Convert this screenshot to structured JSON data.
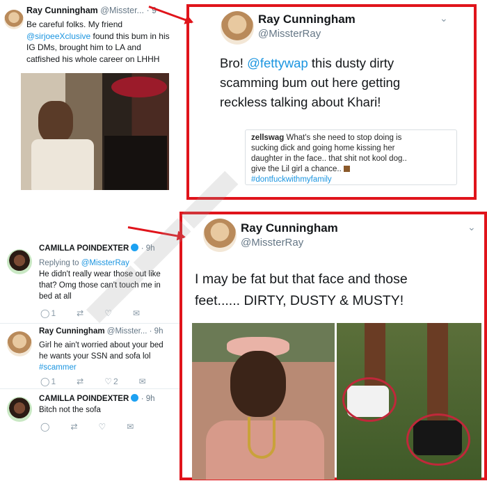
{
  "top_left": {
    "name": "Ray Cunningham",
    "handle": "@Misster...",
    "time": "· 9",
    "line1": "Be careful folks. My friend",
    "mention": "@sirjoeeXclusive",
    "line2_rest": " found this bum in his",
    "line3": "IG DMs, brought him to LA and",
    "line4": "catfished his whole career on LHHH"
  },
  "top_right": {
    "name": "Ray Cunningham",
    "handle": "@MissterRay",
    "bro": "Bro! ",
    "mention": "@fettywap",
    "rest1": " this dusty dirty",
    "line2": "scamming bum out here getting",
    "line3": "reckless talking about Khari!",
    "quote": {
      "user": "zellswag",
      "text1": " What's she need to stop doing is",
      "text2": "sucking dick and going home kissing her",
      "text3": "daughter in the face.. that shit not kool dog..",
      "text4": "give the Lil girl a chance.. ",
      "hashtag": "#dontfuckwithmyfamily"
    }
  },
  "bottom_left": {
    "reply1": {
      "name": "CAMILLA POINDEXTER",
      "time": "· 9h",
      "replying_label": "Replying to ",
      "replying_handle": "@MissterRay",
      "line1": "He didn't really wear those out like",
      "line2": "that? Omg those can't touch me in",
      "line3": "bed at all",
      "reply_count": "1"
    },
    "reply2": {
      "name": "Ray Cunningham",
      "handle": "@Misster...",
      "time": "· 9h",
      "line1": "Girl he ain't worried about your bed",
      "line2": "he wants your SSN and sofa lol",
      "hashtag": "#scammer",
      "reply_count": "1",
      "like_count": "2"
    },
    "reply3": {
      "name": "CAMILLA POINDEXTER",
      "time": "· 9h",
      "line1": "Bitch not the sofa"
    }
  },
  "bottom_right": {
    "name": "Ray Cunningham",
    "handle": "@MissterRay",
    "line1": "I may be fat but that face and those",
    "line2": "feet...... DIRTY, DUSTY & MUSTY!"
  },
  "colors": {
    "highlight": "#e0141b",
    "link": "#1b95e0"
  },
  "icons": [
    "reply-icon",
    "retweet-icon",
    "like-icon",
    "dm-icon",
    "chevron-down-icon",
    "verified-icon"
  ]
}
